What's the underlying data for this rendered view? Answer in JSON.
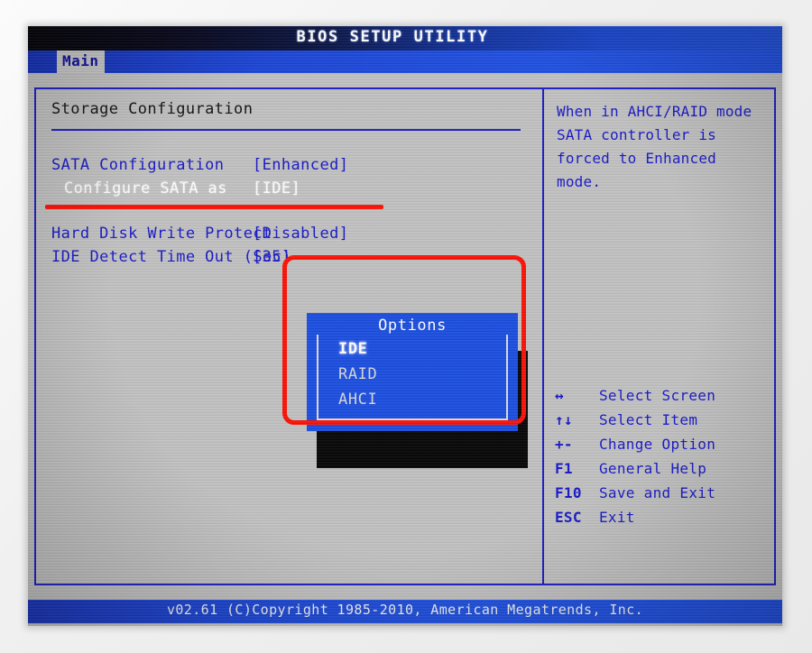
{
  "window": {
    "title": "BIOS SETUP UTILITY"
  },
  "menubar": {
    "tabs": [
      {
        "label": "Main",
        "active": true
      }
    ]
  },
  "settings": {
    "section_title": "Storage Configuration",
    "rows": [
      {
        "label": "SATA Configuration",
        "value": "[Enhanced]"
      },
      {
        "label": "Configure SATA as",
        "value": "[IDE]"
      },
      {
        "label": "Hard Disk Write Protect",
        "value": "[Disabled]"
      },
      {
        "label": "IDE Detect Time Out (Sec)",
        "value": "[35]"
      }
    ]
  },
  "help": {
    "text": "When in AHCI/RAID mode SATA controller is forced to Enhanced mode.",
    "keys": [
      {
        "key": "↔",
        "desc": "Select Screen",
        "icon": "left-right-arrow-icon"
      },
      {
        "key": "↑↓",
        "desc": "Select Item",
        "icon": "up-down-arrow-icon"
      },
      {
        "key": "+-",
        "desc": "Change Option",
        "icon": "plus-minus-icon"
      },
      {
        "key": "F1",
        "desc": "General Help",
        "icon": "f1-key-icon"
      },
      {
        "key": "F10",
        "desc": "Save and Exit",
        "icon": "f10-key-icon"
      },
      {
        "key": "ESC",
        "desc": "Exit",
        "icon": "esc-key-icon"
      }
    ]
  },
  "dialog": {
    "title": "Options",
    "options": [
      {
        "label": "IDE",
        "selected": true
      },
      {
        "label": "RAID",
        "selected": false
      },
      {
        "label": "AHCI",
        "selected": false
      }
    ]
  },
  "footer": {
    "text": "v02.61 (C)Copyright 1985-2010, American Megatrends, Inc."
  },
  "colors": {
    "screen_bg": "#c2c2c2",
    "text_blue": "#1818c8",
    "border_blue": "#1c1cc4",
    "dialog_blue": "#1c4fe0",
    "titlebar_blue": "#1f4fd8",
    "annotation_red": "#fc1205",
    "highlight_white": "#ffffff"
  }
}
